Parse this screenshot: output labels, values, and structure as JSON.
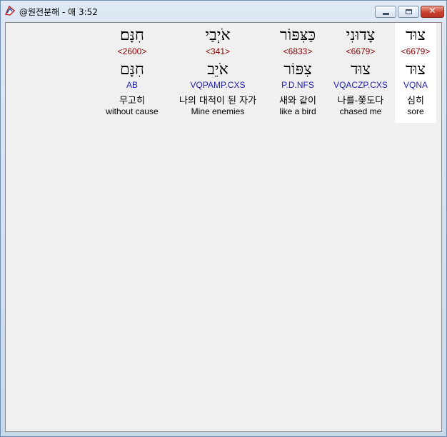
{
  "window": {
    "title": "@원전분해 - 애 3:52",
    "icon": "app-icon",
    "controls": {
      "minimize": "minimize",
      "maximize": "maximize",
      "close": "close"
    }
  },
  "words": [
    {
      "hebrew": "צוּד",
      "strong": "<6679>",
      "lemma": "צוּד",
      "parse": "VQNA",
      "korean": "심히",
      "english": "sore",
      "selected": true
    },
    {
      "hebrew": "צָדוּנִי",
      "strong": "<6679>",
      "lemma": "צוּד",
      "parse": "VQACZP.CXS",
      "korean": "나를-쫓도다",
      "english": "chased me",
      "selected": false
    },
    {
      "hebrew": "כַּצִּפּוֹר",
      "strong": "<6833>",
      "lemma": "צִפּוֹר",
      "parse": "P.D.NFS",
      "korean": "새와 같이",
      "english": "like a bird",
      "selected": false
    },
    {
      "hebrew": "אֹיְבַי",
      "strong": "<341>",
      "lemma": "אֹיֵב",
      "parse": "VQPAMP.CXS",
      "korean": "나의 대적이 된 자가",
      "english": "Mine enemies",
      "selected": false
    },
    {
      "hebrew": "חִנָּם׃",
      "strong": "<2600>",
      "lemma": "חִנָּם",
      "parse": "AB",
      "korean": "무고히",
      "english": "without cause",
      "selected": false
    }
  ],
  "colors": {
    "strong": "#8b0000",
    "parse": "#2020b0",
    "selected_bg": "#ffffff",
    "client_bg": "#f0f0f0"
  }
}
